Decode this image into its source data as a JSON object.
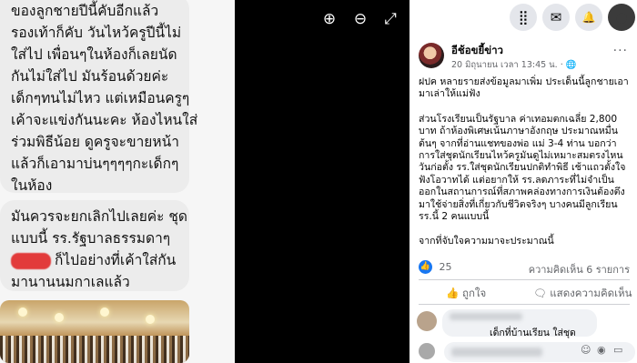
{
  "chat": {
    "bubble1_lines": [
      "ของลูกชายปีนี้คับอีกแล้ว",
      "รองเท้าก็คับ วันไหว้ครูปีนี้ไม่",
      "ใส่ไป เพื่อนๆในห้องก็เลยนัด",
      "กันไม่ใส่ไป มันร้อนด้วยค่ะ",
      "เด็กๆทนไม่ไหว แต่เหมือนครูๆ",
      "เค้าจะแข่งกันนะคะ ห้องไหนใส่",
      "ร่วมพิธีน้อย ดูครูจะขายหน้า",
      "แล้วก็เอามาบ่นๆๆๆๆกะเด็กๆ",
      "ในห้อง"
    ],
    "bubble2_line1": "มันควรจะยกเลิกไปเลยค่ะ ชุด",
    "bubble2_line2": "แบบนี้  รร.รัฐบาลธรรมดาๆ",
    "bubble2_line3": "ก็ไปอย่างที่เค้าใส่กัน",
    "bubble2_line4": "มานานนมกาเลแล้ว"
  },
  "viewer": {
    "zoom_in": "⊕",
    "zoom_out": "⊖",
    "fullscreen": "⤢"
  },
  "topbar": {
    "menu": "⣿",
    "messenger": "✉",
    "bell": "🔔",
    "account": "●"
  },
  "post": {
    "author": "อีช้อขยี้ข่าว",
    "meta": "20 มิถุนายน เวลา 13:45 น. · 🌐",
    "more": "···",
    "paragraphs": [
      "ฝปค หลายรายส่งข้อมูลมาเพิ่ม ประเด็นนี้ลูกชายเอามาเล่าให้แม่ฟัง",
      "ส่วนโรงเรียนเป็นรัฐบาล ค่าเทอมตกเฉลี่ย 2,800 บาท ถ้าห้องพิเศษเน้นภาษาอังกฤษ ประมาณหมื่นต้นๆ จากที่อ่านแชทของพ่อ แม่ 3-4 ท่าน บอกว่า การใส่ชุดนักเรียนไหว้ครูมันดูไม่เหมาะสมตรงไหน วันก่อตั้ง รร.ใส่ชุดนักเรียนปกติทำพิธี เช้าแถวตั้งใจฟังโอวาทได้ แต่อยากให้ รร.ลดภาระที่ไม่จำเป็นออกในสถานการณ์ที่สภาพคล่องทางการเงินต้องตึงมาใช้จ่ายสิ่งที่เกี่ยวกับชีวิตจริงๆ บางคนมีลูกเรียน รร.นี้ 2 คนแบบนี้",
      "จากที่จับใจความมาจะประมาณนี้"
    ],
    "reaction_count": "25",
    "comment_count": "ความคิดเห็น 6 รายการ",
    "like_label": "ถูกใจ",
    "comment_label": "แสดงความคิดเห็น",
    "comment1_partial": "เด็กที่บ้านเรียน ใส่ชุด"
  }
}
